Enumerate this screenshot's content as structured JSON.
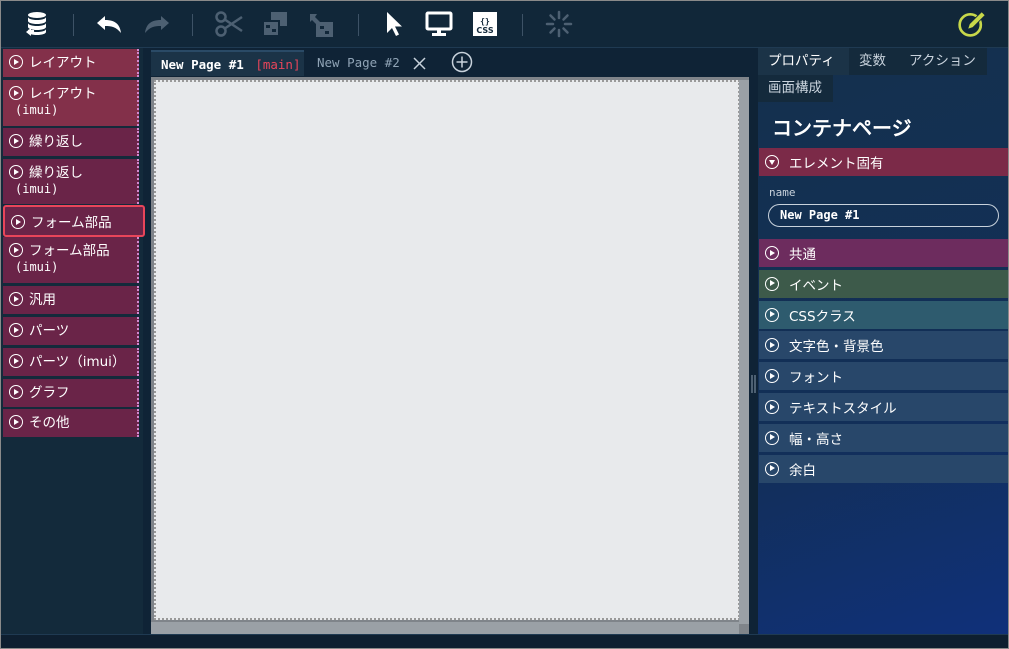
{
  "toolbar": {
    "icons": [
      "database-icon",
      "undo-icon",
      "redo-icon",
      "cut-icon",
      "copy-icon",
      "paste-icon",
      "pointer-icon",
      "monitor-icon",
      "css-icon",
      "loading-icon",
      "edit-icon"
    ],
    "css_label": "CSS",
    "css_braces": "{}"
  },
  "palette": {
    "categories": [
      {
        "label": "レイアウト",
        "sub": ""
      },
      {
        "label": "レイアウト",
        "sub": "(imui)"
      },
      {
        "label": "繰り返し",
        "sub": ""
      },
      {
        "label": "繰り返し",
        "sub": "(imui)"
      },
      {
        "label": "フォーム部品",
        "sub": ""
      },
      {
        "label": "フォーム部品",
        "sub": "(imui)"
      },
      {
        "label": "汎用",
        "sub": ""
      },
      {
        "label": "パーツ",
        "sub": ""
      },
      {
        "label": "パーツ（imui）",
        "sub": ""
      },
      {
        "label": "グラフ",
        "sub": ""
      },
      {
        "label": "その他",
        "sub": ""
      }
    ],
    "highlighted_index": 4
  },
  "tabs": [
    {
      "label": "New Page #1",
      "tag": "[main]",
      "active": true
    },
    {
      "label": "New Page #2",
      "tag": "",
      "active": false
    }
  ],
  "right_panel": {
    "tabs": [
      "プロパティ",
      "変数",
      "アクション"
    ],
    "subtab": "画面構成",
    "title": "コンテナページ",
    "element_section": "エレメント固有",
    "name_label": "name",
    "name_value": "New Page #1",
    "sections": [
      "共通",
      "イベント",
      "CSSクラス",
      "文字色・背景色",
      "フォント",
      "テキストスタイル",
      "幅・高さ",
      "余白"
    ]
  },
  "colors": {
    "accent_red": "#e8455a",
    "element_section": "#7b2a48",
    "common": "#6d2c5e",
    "event": "#3d5a4a",
    "cssclass": "#2e5b6e"
  }
}
